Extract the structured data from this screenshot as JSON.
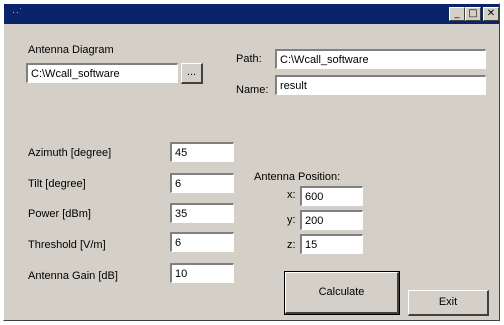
{
  "window": {
    "title_icon": "app-icon",
    "controls": {
      "minimize": "_",
      "maximize": "□",
      "close": "✕"
    }
  },
  "antenna_diagram": {
    "label": "Antenna Diagram",
    "value": "C:\\Wcall_software",
    "browse_label": "..."
  },
  "path": {
    "label": "Path:",
    "value": "C:\\Wcall_software"
  },
  "name": {
    "label": "Name:",
    "value": "result"
  },
  "params": [
    {
      "label": "Azimuth [degree]",
      "value": "45"
    },
    {
      "label": "Tilt [degree]",
      "value": "6"
    },
    {
      "label": "Power [dBm]",
      "value": "35"
    },
    {
      "label": "Threshold [V/m]",
      "value": "6"
    },
    {
      "label": "Antenna Gain [dB]",
      "value": "10"
    }
  ],
  "position": {
    "label": "Antenna Position:",
    "x": {
      "label": "x:",
      "value": "600"
    },
    "y": {
      "label": "y:",
      "value": "200"
    },
    "z": {
      "label": "z:",
      "value": "15"
    }
  },
  "buttons": {
    "calculate": "Calculate",
    "exit": "Exit"
  },
  "colors": {
    "titlebar": "#0a246a",
    "face": "#d4d0c8"
  }
}
